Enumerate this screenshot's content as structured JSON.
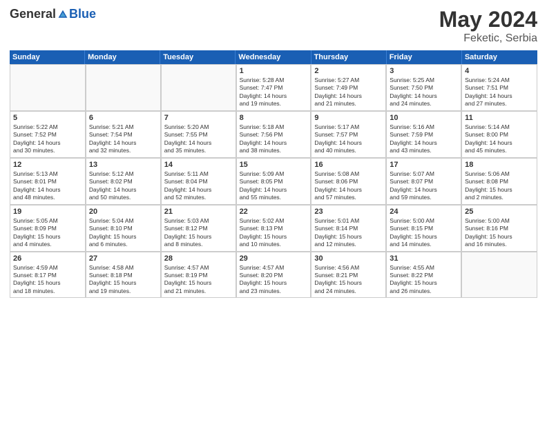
{
  "header": {
    "logo": {
      "general": "General",
      "blue": "Blue"
    },
    "title": "May 2024",
    "location": "Feketic, Serbia"
  },
  "weekdays": [
    "Sunday",
    "Monday",
    "Tuesday",
    "Wednesday",
    "Thursday",
    "Friday",
    "Saturday"
  ],
  "weeks": [
    [
      {
        "day": "",
        "lines": []
      },
      {
        "day": "",
        "lines": []
      },
      {
        "day": "",
        "lines": []
      },
      {
        "day": "1",
        "lines": [
          "Sunrise: 5:28 AM",
          "Sunset: 7:47 PM",
          "Daylight: 14 hours",
          "and 19 minutes."
        ]
      },
      {
        "day": "2",
        "lines": [
          "Sunrise: 5:27 AM",
          "Sunset: 7:49 PM",
          "Daylight: 14 hours",
          "and 21 minutes."
        ]
      },
      {
        "day": "3",
        "lines": [
          "Sunrise: 5:25 AM",
          "Sunset: 7:50 PM",
          "Daylight: 14 hours",
          "and 24 minutes."
        ]
      },
      {
        "day": "4",
        "lines": [
          "Sunrise: 5:24 AM",
          "Sunset: 7:51 PM",
          "Daylight: 14 hours",
          "and 27 minutes."
        ]
      }
    ],
    [
      {
        "day": "5",
        "lines": [
          "Sunrise: 5:22 AM",
          "Sunset: 7:52 PM",
          "Daylight: 14 hours",
          "and 30 minutes."
        ]
      },
      {
        "day": "6",
        "lines": [
          "Sunrise: 5:21 AM",
          "Sunset: 7:54 PM",
          "Daylight: 14 hours",
          "and 32 minutes."
        ]
      },
      {
        "day": "7",
        "lines": [
          "Sunrise: 5:20 AM",
          "Sunset: 7:55 PM",
          "Daylight: 14 hours",
          "and 35 minutes."
        ]
      },
      {
        "day": "8",
        "lines": [
          "Sunrise: 5:18 AM",
          "Sunset: 7:56 PM",
          "Daylight: 14 hours",
          "and 38 minutes."
        ]
      },
      {
        "day": "9",
        "lines": [
          "Sunrise: 5:17 AM",
          "Sunset: 7:57 PM",
          "Daylight: 14 hours",
          "and 40 minutes."
        ]
      },
      {
        "day": "10",
        "lines": [
          "Sunrise: 5:16 AM",
          "Sunset: 7:59 PM",
          "Daylight: 14 hours",
          "and 43 minutes."
        ]
      },
      {
        "day": "11",
        "lines": [
          "Sunrise: 5:14 AM",
          "Sunset: 8:00 PM",
          "Daylight: 14 hours",
          "and 45 minutes."
        ]
      }
    ],
    [
      {
        "day": "12",
        "lines": [
          "Sunrise: 5:13 AM",
          "Sunset: 8:01 PM",
          "Daylight: 14 hours",
          "and 48 minutes."
        ]
      },
      {
        "day": "13",
        "lines": [
          "Sunrise: 5:12 AM",
          "Sunset: 8:02 PM",
          "Daylight: 14 hours",
          "and 50 minutes."
        ]
      },
      {
        "day": "14",
        "lines": [
          "Sunrise: 5:11 AM",
          "Sunset: 8:04 PM",
          "Daylight: 14 hours",
          "and 52 minutes."
        ]
      },
      {
        "day": "15",
        "lines": [
          "Sunrise: 5:09 AM",
          "Sunset: 8:05 PM",
          "Daylight: 14 hours",
          "and 55 minutes."
        ]
      },
      {
        "day": "16",
        "lines": [
          "Sunrise: 5:08 AM",
          "Sunset: 8:06 PM",
          "Daylight: 14 hours",
          "and 57 minutes."
        ]
      },
      {
        "day": "17",
        "lines": [
          "Sunrise: 5:07 AM",
          "Sunset: 8:07 PM",
          "Daylight: 14 hours",
          "and 59 minutes."
        ]
      },
      {
        "day": "18",
        "lines": [
          "Sunrise: 5:06 AM",
          "Sunset: 8:08 PM",
          "Daylight: 15 hours",
          "and 2 minutes."
        ]
      }
    ],
    [
      {
        "day": "19",
        "lines": [
          "Sunrise: 5:05 AM",
          "Sunset: 8:09 PM",
          "Daylight: 15 hours",
          "and 4 minutes."
        ]
      },
      {
        "day": "20",
        "lines": [
          "Sunrise: 5:04 AM",
          "Sunset: 8:10 PM",
          "Daylight: 15 hours",
          "and 6 minutes."
        ]
      },
      {
        "day": "21",
        "lines": [
          "Sunrise: 5:03 AM",
          "Sunset: 8:12 PM",
          "Daylight: 15 hours",
          "and 8 minutes."
        ]
      },
      {
        "day": "22",
        "lines": [
          "Sunrise: 5:02 AM",
          "Sunset: 8:13 PM",
          "Daylight: 15 hours",
          "and 10 minutes."
        ]
      },
      {
        "day": "23",
        "lines": [
          "Sunrise: 5:01 AM",
          "Sunset: 8:14 PM",
          "Daylight: 15 hours",
          "and 12 minutes."
        ]
      },
      {
        "day": "24",
        "lines": [
          "Sunrise: 5:00 AM",
          "Sunset: 8:15 PM",
          "Daylight: 15 hours",
          "and 14 minutes."
        ]
      },
      {
        "day": "25",
        "lines": [
          "Sunrise: 5:00 AM",
          "Sunset: 8:16 PM",
          "Daylight: 15 hours",
          "and 16 minutes."
        ]
      }
    ],
    [
      {
        "day": "26",
        "lines": [
          "Sunrise: 4:59 AM",
          "Sunset: 8:17 PM",
          "Daylight: 15 hours",
          "and 18 minutes."
        ]
      },
      {
        "day": "27",
        "lines": [
          "Sunrise: 4:58 AM",
          "Sunset: 8:18 PM",
          "Daylight: 15 hours",
          "and 19 minutes."
        ]
      },
      {
        "day": "28",
        "lines": [
          "Sunrise: 4:57 AM",
          "Sunset: 8:19 PM",
          "Daylight: 15 hours",
          "and 21 minutes."
        ]
      },
      {
        "day": "29",
        "lines": [
          "Sunrise: 4:57 AM",
          "Sunset: 8:20 PM",
          "Daylight: 15 hours",
          "and 23 minutes."
        ]
      },
      {
        "day": "30",
        "lines": [
          "Sunrise: 4:56 AM",
          "Sunset: 8:21 PM",
          "Daylight: 15 hours",
          "and 24 minutes."
        ]
      },
      {
        "day": "31",
        "lines": [
          "Sunrise: 4:55 AM",
          "Sunset: 8:22 PM",
          "Daylight: 15 hours",
          "and 26 minutes."
        ]
      },
      {
        "day": "",
        "lines": []
      }
    ]
  ]
}
